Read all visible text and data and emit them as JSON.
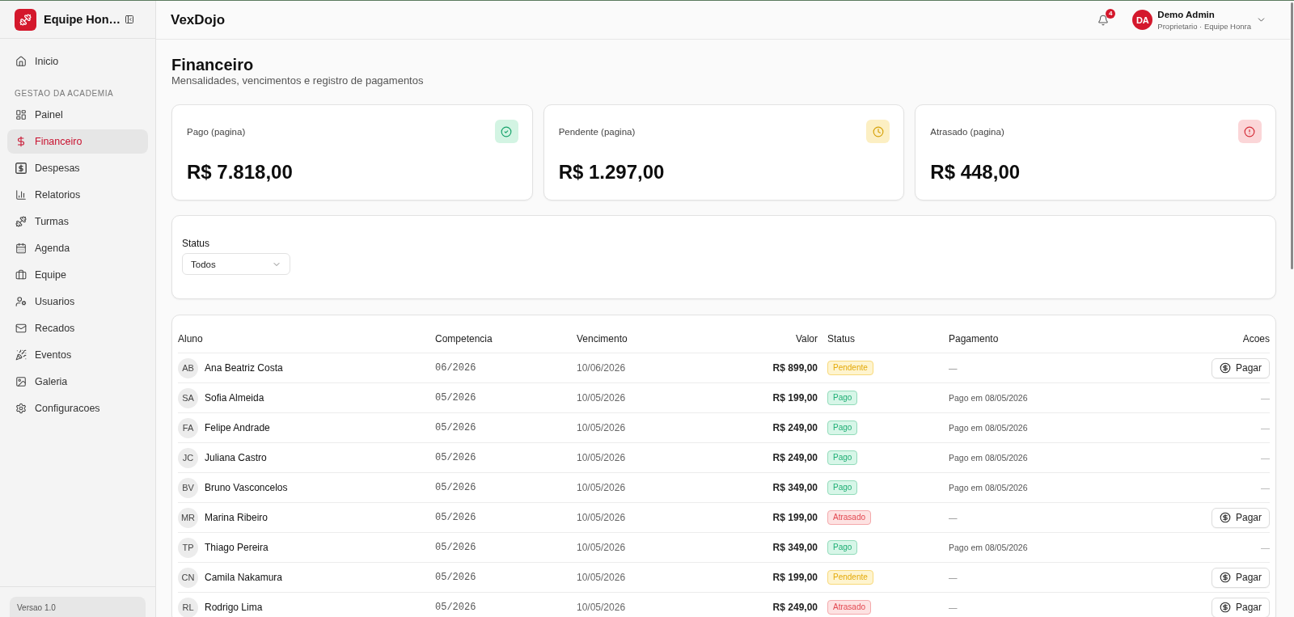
{
  "sidebar": {
    "brand": "Equipe Hon…",
    "nav": [
      {
        "label": "Inicio",
        "selected": false
      }
    ],
    "section": {
      "title": "GESTAO DA ACADEMIA",
      "items": [
        {
          "label": "Painel",
          "selected": false
        },
        {
          "label": "Financeiro",
          "selected": true
        },
        {
          "label": "Despesas",
          "selected": false
        },
        {
          "label": "Relatorios",
          "selected": false
        },
        {
          "label": "Turmas",
          "selected": false
        },
        {
          "label": "Agenda",
          "selected": false
        },
        {
          "label": "Equipe",
          "selected": false
        },
        {
          "label": "Usuarios",
          "selected": false
        },
        {
          "label": "Recados",
          "selected": false
        },
        {
          "label": "Eventos",
          "selected": false
        },
        {
          "label": "Galeria",
          "selected": false
        },
        {
          "label": "Configuracoes",
          "selected": false
        }
      ]
    },
    "footer": {
      "version": "Versao 1.0"
    }
  },
  "header": {
    "title": "VexDojo",
    "notifications": "4",
    "user": {
      "initials": "DA",
      "name": "Demo Admin",
      "role": "Proprietario · Equipe Honra"
    }
  },
  "page": {
    "title": "Financeiro",
    "subtitle": "Mensalidades, vencimentos e registro de pagamentos"
  },
  "summary_cards": [
    {
      "kind": "paid",
      "label": "Pago (pagina)",
      "value": "R$ 7.818,00"
    },
    {
      "kind": "pending",
      "label": "Pendente (pagina)",
      "value": "R$ 1.297,00"
    },
    {
      "kind": "overdue",
      "label": "Atrasado (pagina)",
      "value": "R$ 448,00"
    }
  ],
  "filter": {
    "label": "Status",
    "value": "Todos"
  },
  "table": {
    "columns": [
      "Aluno",
      "Competencia",
      "Vencimento",
      "Valor",
      "Status",
      "Pagamento",
      "Acoes"
    ],
    "rows": [
      {
        "initials": "AB",
        "student": "Ana Beatriz Costa",
        "competencia": "06/2026",
        "vencimento": "10/06/2026",
        "valor": "R$ 899,00",
        "status": {
          "kind": "pending",
          "label": "Pendente"
        },
        "pagamento": "—",
        "action": {
          "kind": "button",
          "label": "Pagar"
        }
      },
      {
        "initials": "SA",
        "student": "Sofia Almeida",
        "competencia": "05/2026",
        "vencimento": "10/05/2026",
        "valor": "R$ 199,00",
        "status": {
          "kind": "paid",
          "label": "Pago"
        },
        "pagamento": "Pago em 08/05/2026",
        "action": {
          "kind": "none",
          "label": "—"
        }
      },
      {
        "initials": "FA",
        "student": "Felipe Andrade",
        "competencia": "05/2026",
        "vencimento": "10/05/2026",
        "valor": "R$ 249,00",
        "status": {
          "kind": "paid",
          "label": "Pago"
        },
        "pagamento": "Pago em 08/05/2026",
        "action": {
          "kind": "none",
          "label": "—"
        }
      },
      {
        "initials": "JC",
        "student": "Juliana Castro",
        "competencia": "05/2026",
        "vencimento": "10/05/2026",
        "valor": "R$ 249,00",
        "status": {
          "kind": "paid",
          "label": "Pago"
        },
        "pagamento": "Pago em 08/05/2026",
        "action": {
          "kind": "none",
          "label": "—"
        }
      },
      {
        "initials": "BV",
        "student": "Bruno Vasconcelos",
        "competencia": "05/2026",
        "vencimento": "10/05/2026",
        "valor": "R$ 349,00",
        "status": {
          "kind": "paid",
          "label": "Pago"
        },
        "pagamento": "Pago em 08/05/2026",
        "action": {
          "kind": "none",
          "label": "—"
        }
      },
      {
        "initials": "MR",
        "student": "Marina Ribeiro",
        "competencia": "05/2026",
        "vencimento": "10/05/2026",
        "valor": "R$ 199,00",
        "status": {
          "kind": "overdue",
          "label": "Atrasado"
        },
        "pagamento": "—",
        "action": {
          "kind": "button",
          "label": "Pagar"
        }
      },
      {
        "initials": "TP",
        "student": "Thiago Pereira",
        "competencia": "05/2026",
        "vencimento": "10/05/2026",
        "valor": "R$ 349,00",
        "status": {
          "kind": "paid",
          "label": "Pago"
        },
        "pagamento": "Pago em 08/05/2026",
        "action": {
          "kind": "none",
          "label": "—"
        }
      },
      {
        "initials": "CN",
        "student": "Camila Nakamura",
        "competencia": "05/2026",
        "vencimento": "10/05/2026",
        "valor": "R$ 199,00",
        "status": {
          "kind": "pending",
          "label": "Pendente"
        },
        "pagamento": "—",
        "action": {
          "kind": "button",
          "label": "Pagar"
        }
      },
      {
        "initials": "RL",
        "student": "Rodrigo Lima",
        "competencia": "05/2026",
        "vencimento": "10/05/2026",
        "valor": "R$ 249,00",
        "status": {
          "kind": "overdue",
          "label": "Atrasado"
        },
        "pagamento": "—",
        "action": {
          "kind": "button",
          "label": "Pagar"
        }
      }
    ]
  }
}
